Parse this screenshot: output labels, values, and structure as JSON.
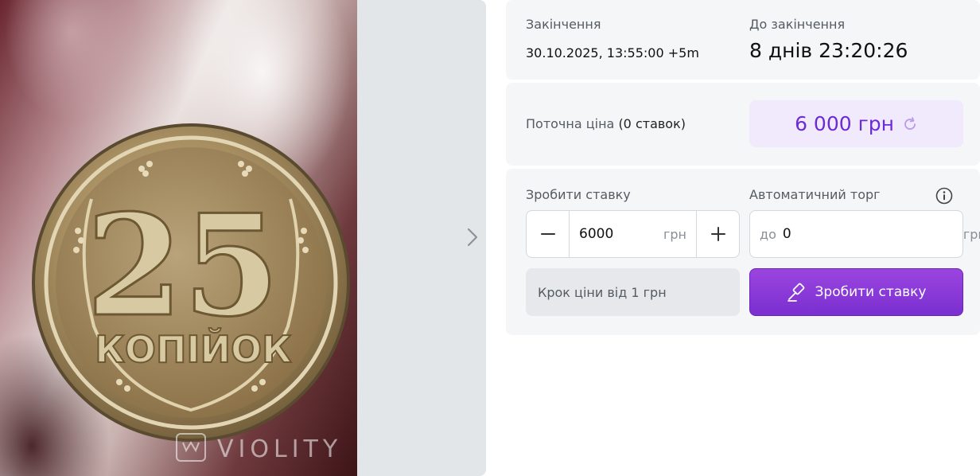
{
  "gallery": {
    "coin": {
      "denomination": "25",
      "word": "КОПІЙОК"
    },
    "watermark": "VIOLITY",
    "next_icon": "chevron-right-icon"
  },
  "auction": {
    "end_label": "Закінчення",
    "end_value": "30.10.2025, 13:55:00 +5m",
    "time_left_label": "До закінчення",
    "time_left_value": "8 днів 23:20:26",
    "current_price_label": "Поточна ціна",
    "bids_count": "(0 ставок)",
    "current_price": "6 000 грн",
    "refresh_icon": "refresh-icon"
  },
  "bid": {
    "make_bid_label": "Зробити ставку",
    "amount": "6000",
    "unit": "грн",
    "minus_icon": "minus-icon",
    "plus_icon": "plus-icon",
    "auto_label": "Автоматичний торг",
    "auto_prefix": "до",
    "auto_value": "0",
    "auto_unit": "грн",
    "info_icon": "info-icon",
    "step_hint": "Крок ціни від 1 грн",
    "button_label": "Зробити ставку",
    "button_icon": "gavel-icon"
  },
  "colors": {
    "accent": "#7a2fd0",
    "price_text": "#6b2bd6",
    "price_bg": "#f1e9fc",
    "card_bg": "#f5f6f7"
  }
}
